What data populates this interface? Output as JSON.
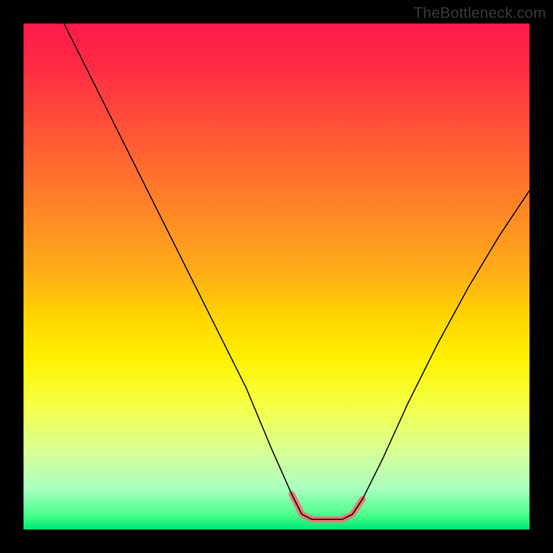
{
  "watermark": "TheBottleneck.com",
  "chart_data": {
    "type": "line",
    "title": "",
    "xlabel": "",
    "ylabel": "",
    "xlim": [
      0,
      100
    ],
    "ylim": [
      0,
      100
    ],
    "series": [
      {
        "name": "main-curve",
        "color": "#000000",
        "width": 1.6,
        "points": [
          {
            "x": 8,
            "y": 100
          },
          {
            "x": 14,
            "y": 88
          },
          {
            "x": 20,
            "y": 76
          },
          {
            "x": 26,
            "y": 64
          },
          {
            "x": 32,
            "y": 52
          },
          {
            "x": 38,
            "y": 40
          },
          {
            "x": 44,
            "y": 28
          },
          {
            "x": 49,
            "y": 16
          },
          {
            "x": 53,
            "y": 7
          },
          {
            "x": 55,
            "y": 3
          },
          {
            "x": 57,
            "y": 2
          },
          {
            "x": 59,
            "y": 2
          },
          {
            "x": 61,
            "y": 2
          },
          {
            "x": 63,
            "y": 2
          },
          {
            "x": 65,
            "y": 3
          },
          {
            "x": 67,
            "y": 6
          },
          {
            "x": 71,
            "y": 14
          },
          {
            "x": 76,
            "y": 25
          },
          {
            "x": 82,
            "y": 37
          },
          {
            "x": 88,
            "y": 48
          },
          {
            "x": 94,
            "y": 58
          },
          {
            "x": 100,
            "y": 67
          }
        ]
      },
      {
        "name": "valley-highlight",
        "color": "#e97a76",
        "width": 9,
        "linecap": "round",
        "points": [
          {
            "x": 53,
            "y": 7
          },
          {
            "x": 55,
            "y": 3
          },
          {
            "x": 57,
            "y": 2
          },
          {
            "x": 60,
            "y": 2
          },
          {
            "x": 63,
            "y": 2
          },
          {
            "x": 65,
            "y": 3
          },
          {
            "x": 67,
            "y": 6
          }
        ]
      }
    ],
    "background_gradient": {
      "direction": "top-to-bottom",
      "stops": [
        {
          "pos": 0,
          "color": "#ff1a4b"
        },
        {
          "pos": 50,
          "color": "#ffa91a"
        },
        {
          "pos": 66,
          "color": "#fff000"
        },
        {
          "pos": 100,
          "color": "#00e676"
        }
      ]
    }
  }
}
